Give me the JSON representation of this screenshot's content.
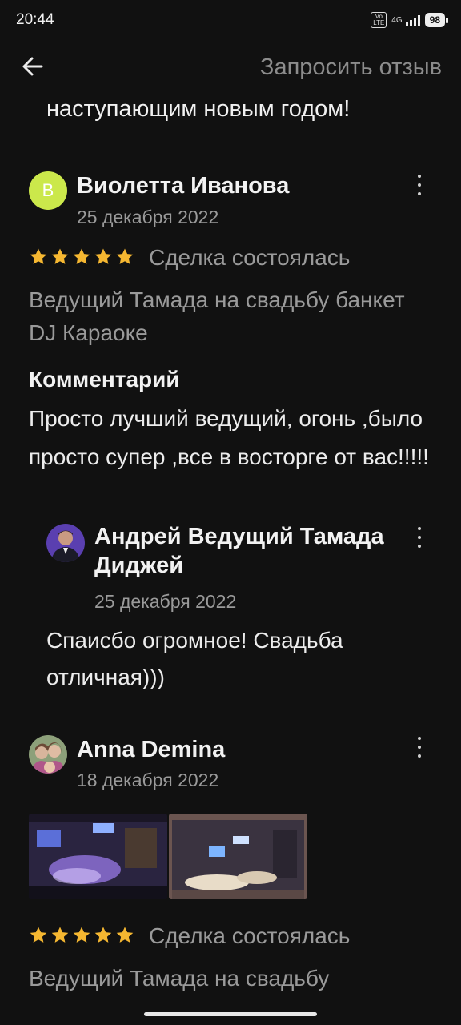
{
  "status_bar": {
    "time": "20:44",
    "volte": "Vo LTE",
    "network": "4G",
    "battery": "98"
  },
  "header": {
    "back_icon": "arrow-left-icon",
    "request_review_label": "Запросить отзыв"
  },
  "previous_review_tail": "наступающим новым годом!",
  "reviews": [
    {
      "avatar_letter": "В",
      "avatar_color": "#cbe84b",
      "author": "Виолетта Иванова",
      "date": "25 декабря 2022",
      "rating": 5,
      "deal_status": "Сделка состоялась",
      "service": "Ведущий Тамада на свадьбу банкет DJ Караоке",
      "comment_heading": "Комментарий",
      "comment": "Просто лучший ведущий, огонь ,было просто супер ,все в восторге от вас!!!!!",
      "reply": {
        "author": "Андрей Ведущий Тамада Диджей",
        "date": "25 декабря 2022",
        "text": "Спаисбо огромное! Свадьба отличная)))"
      }
    },
    {
      "author": "Anna Demina",
      "date": "18 декабря 2022",
      "rating": 5,
      "deal_status": "Сделка состоялась",
      "service": "Ведущий Тамада на свадьбу"
    }
  ],
  "colors": {
    "background": "#111111",
    "star": "#f5b731",
    "muted_text": "#9a9a9a"
  }
}
